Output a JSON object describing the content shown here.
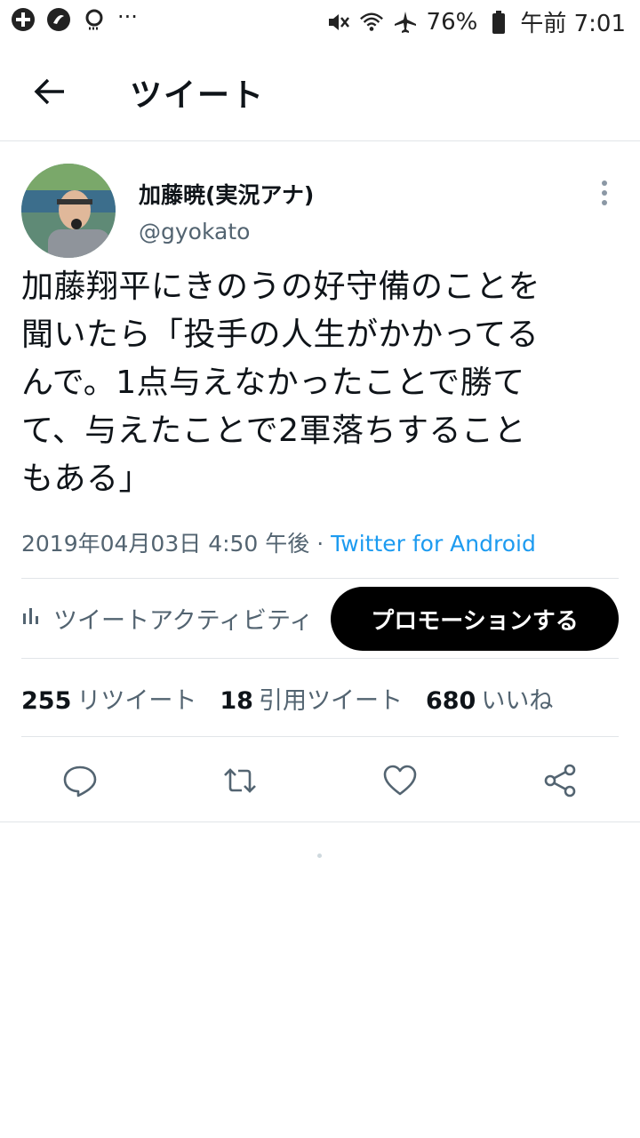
{
  "status_bar": {
    "battery": "76%",
    "time": "午前 7:01",
    "overflow": "···"
  },
  "header": {
    "title": "ツイート"
  },
  "tweet": {
    "display_name": "加藤暁(実況アナ)",
    "handle": "@gyokato",
    "text": "加藤翔平にきのうの好守備のことを\n聞いたら「投手の人生がかかってる\nんで。1点与えなかったことで勝て\nて、与えたことで2軍落ちすること\nもある」",
    "timestamp": "2019年04月03日 4:50 午後 · ",
    "source": "Twitter for Android"
  },
  "activity": {
    "label": "ツイートアクティビティ",
    "promote_button": "プロモーションする"
  },
  "stats": {
    "retweets_count": "255",
    "retweets_label": "リツイート",
    "quotes_count": "18",
    "quotes_label": "引用ツイート",
    "likes_count": "680",
    "likes_label": "いいね"
  },
  "colors": {
    "accent": "#1d9bf0",
    "text": "#0f1419",
    "secondary": "#536471",
    "divider": "#e1e5e8"
  },
  "icons": [
    "add-circle-icon",
    "jal-icon",
    "search-app-icon",
    "mute-icon",
    "wifi-icon",
    "airplane-icon",
    "battery-icon",
    "back-arrow-icon",
    "more-vertical-icon",
    "chart-icon",
    "reply-icon",
    "retweet-icon",
    "like-icon",
    "share-icon"
  ]
}
